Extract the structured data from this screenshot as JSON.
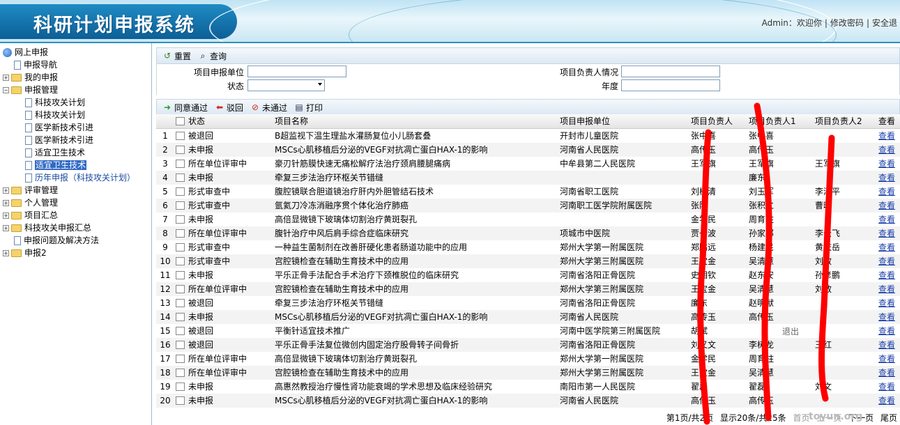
{
  "header": {
    "title": "科研计划申报系统",
    "user_text": "Admin：欢迎你",
    "links": [
      "修改密码",
      "安全退"
    ]
  },
  "sidebar": {
    "root": "网上申报",
    "items": [
      {
        "label": "申报导航",
        "level": 1,
        "type": "doc"
      },
      {
        "label": "我的申报",
        "level": 0,
        "type": "folder",
        "expanded": false
      },
      {
        "label": "申报管理",
        "level": 0,
        "type": "folder",
        "expanded": true
      },
      {
        "label": "科技攻关计划",
        "level": 2,
        "type": "doc"
      },
      {
        "label": "科技攻关计划",
        "level": 2,
        "type": "doc"
      },
      {
        "label": "医学新技术引进",
        "level": 2,
        "type": "doc"
      },
      {
        "label": "医学新技术引进",
        "level": 2,
        "type": "doc"
      },
      {
        "label": "适宜卫生技术",
        "level": 2,
        "type": "doc"
      },
      {
        "label": "适宜卫生技术",
        "level": 2,
        "type": "doc",
        "selected": true
      },
      {
        "label": "历年申报（科技攻关计划）",
        "level": 2,
        "type": "doc",
        "blue": true
      },
      {
        "label": "评审管理",
        "level": 0,
        "type": "folder",
        "expanded": false
      },
      {
        "label": "个人管理",
        "level": 0,
        "type": "folder",
        "expanded": false
      },
      {
        "label": "项目汇总",
        "level": 0,
        "type": "folder",
        "expanded": false
      },
      {
        "label": "科技攻关申报汇总",
        "level": 0,
        "type": "folder",
        "expanded": false
      },
      {
        "label": "申报问题及解决方法",
        "level": 1,
        "type": "doc"
      },
      {
        "label": "申报2",
        "level": 0,
        "type": "folder",
        "expanded": false
      }
    ]
  },
  "toolbar": {
    "reset": "重置",
    "query": "查询"
  },
  "search": {
    "unit_label": "项目申报单位",
    "unit_value": "",
    "status_label": "状态",
    "status_value": "",
    "leader_label": "项目负责人情况",
    "leader_value": "",
    "year_label": "年度",
    "year_value": ""
  },
  "actions": {
    "approve": "同意通过",
    "reject": "驳回",
    "fail": "未通过",
    "print": "打印"
  },
  "grid": {
    "columns": {
      "status": "状态",
      "name": "项目名称",
      "unit": "项目申报单位",
      "p0": "项目负责人",
      "p1": "项目负责人1",
      "p2": "项目负责人2",
      "view": "查看"
    },
    "rows": [
      {
        "no": "1",
        "status": "被退回",
        "name": "B超监视下温生理盐水灌肠复位小儿肠套叠",
        "unit": "开封市儿童医院",
        "p0": "张中喜",
        "p1": "张中喜",
        "p2": "",
        "view": "查看"
      },
      {
        "no": "2",
        "status": "未申报",
        "name": "MSCs心肌移植后分泌的VEGF对抗凋亡蛋白HAX-1的影响",
        "unit": "河南省人民医院",
        "p0": "高传玉",
        "p1": "高传玉",
        "p2": "",
        "view": "查看"
      },
      {
        "no": "3",
        "status": "所在单位评审中",
        "name": "豪刃针筋膜快速无痛松解疗法治疗颈肩腰腿痛病",
        "unit": "中牟县第二人民医院",
        "p0": "王军旗",
        "p1": "王军旗",
        "p2": "王军旗",
        "view": "查看"
      },
      {
        "no": "4",
        "status": "未申报",
        "name": "牵复三步法治疗环枢关节错缝",
        "unit": "",
        "p0": "",
        "p1": "廉东",
        "p2": "",
        "view": "查看"
      },
      {
        "no": "5",
        "status": "形式审查中",
        "name": "腹腔镜联合胆道镜治疗肝内外胆管结石技术",
        "unit": "河南省职工医院",
        "p0": "刘树清",
        "p1": "刘玉军",
        "p2": "李泽平",
        "view": "查看"
      },
      {
        "no": "6",
        "status": "形式审查中",
        "name": "氩氦刀冷冻消融序贯个体化治疗肺癌",
        "unit": "河南职工医学院附属医院",
        "p0": "张阳",
        "p1": "张积仁",
        "p2": "曹晖",
        "view": "查看"
      },
      {
        "no": "7",
        "status": "未申报",
        "name": "高倍显微镜下玻璃体切割治疗黄斑裂孔",
        "unit": "",
        "p0": "金学民",
        "p1": "周育柱",
        "p2": "",
        "view": "查看"
      },
      {
        "no": "8",
        "status": "所在单位评审中",
        "name": "腹针治疗中风后肩手综合症临床研究",
        "unit": "项城市中医院",
        "p0": "贾一波",
        "p1": "孙家邦",
        "p2": "李云飞",
        "view": "查看"
      },
      {
        "no": "9",
        "status": "形式审查中",
        "name": "一种益生菌制剂在改善肝硬化患者肠道功能中的应用",
        "unit": "郑州大学第一附属医院",
        "p0": "郑鹏远",
        "p1": "杨建民",
        "p2": "黄庆岳",
        "view": "查看"
      },
      {
        "no": "10",
        "status": "形式审查中",
        "name": "宫腔镜检查在辅助生育技术中的应用",
        "unit": "郑州大学第三附属医院",
        "p0": "王宝金",
        "p1": "吴清慧",
        "p2": "刘敏",
        "view": "查看"
      },
      {
        "no": "11",
        "status": "未申报",
        "name": "平乐正骨手法配合手术治疗下颈椎脱位的临床研究",
        "unit": "河南省洛阳正骨医院",
        "p0": "史相钦",
        "p1": "赵东安",
        "p2": "孙彦鹏",
        "view": "查看"
      },
      {
        "no": "12",
        "status": "所在单位评审中",
        "name": "宫腔镜检查在辅助生育技术中的应用",
        "unit": "郑州大学第三附属医院",
        "p0": "王宝金",
        "p1": "吴清慧",
        "p2": "刘敏",
        "view": "查看"
      },
      {
        "no": "13",
        "status": "被退回",
        "name": "牵复三步法治疗环枢关节错缝",
        "unit": "河南省洛阳正骨医院",
        "p0": "廉东",
        "p1": "赵明献",
        "p2": "",
        "view": "查看"
      },
      {
        "no": "14",
        "status": "未申报",
        "name": "MSCs心肌移植后分泌的VEGF对抗凋亡蛋白HAX-1的影响",
        "unit": "河南省人民医院",
        "p0": "高传玉",
        "p1": "高传玉",
        "p2": "",
        "view": "查看"
      },
      {
        "no": "15",
        "status": "被退回",
        "name": "平衡针适宜技术推广",
        "unit": "河南中医学院第三附属医院",
        "p0": "胡斌",
        "p1": "",
        "p2": "",
        "view": "查看"
      },
      {
        "no": "16",
        "status": "被退回",
        "name": "平乐正骨手法复位微创内固定治疗股骨转子间骨折",
        "unit": "河南省洛阳正骨医院",
        "p0": "刘又文",
        "p1": "李树龙",
        "p2": "王红",
        "view": "查看"
      },
      {
        "no": "17",
        "status": "所在单位评审中",
        "name": "高倍显微镜下玻璃体切割治疗黄斑裂孔",
        "unit": "郑州大学第一附属医院",
        "p0": "金学民",
        "p1": "周育柱",
        "p2": "",
        "view": "查看"
      },
      {
        "no": "18",
        "status": "所在单位评审中",
        "name": "宫腔镜检查在辅助生育技术中的应用",
        "unit": "郑州大学第三附属医院",
        "p0": "王宝金",
        "p1": "吴清慧",
        "p2": "",
        "view": "查看"
      },
      {
        "no": "19",
        "status": "未申报",
        "name": "高惠然教授治疗慢性肾功能衰竭的学术思想及临床经验研究",
        "unit": "南阳市第一人民医院",
        "p0": "翟磊",
        "p1": "翟磊",
        "p2": "刘文",
        "view": "查看"
      },
      {
        "no": "20",
        "status": "未申报",
        "name": "MSCs心肌移植后分泌的VEGF对抗凋亡蛋白HAX-1的影响",
        "unit": "河南省人民医院",
        "p0": "高传玉",
        "p1": "高传玉",
        "p2": "",
        "view": "查看"
      }
    ]
  },
  "overlay": {
    "logout": "退出"
  },
  "pager": {
    "page": "第1页/共2页",
    "count": "显示20条/共25条",
    "first": "首页",
    "prev": "上一页",
    "next": "下一页",
    "last": "尾页"
  },
  "watermark": "toyun.org"
}
